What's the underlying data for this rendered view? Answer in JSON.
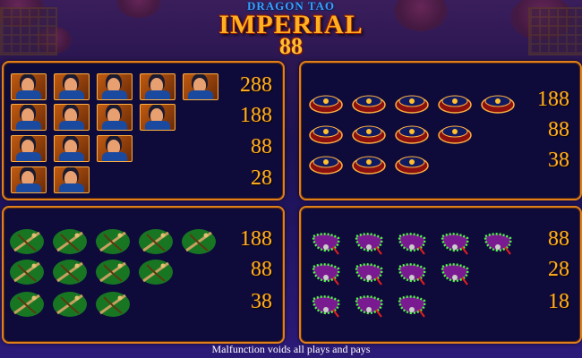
{
  "logo": {
    "subtitle": "DRAGON TAO",
    "title": "IMPERIAL",
    "number": "88"
  },
  "footer": {
    "text": "Malfunction voids all plays and pays"
  },
  "colors": {
    "panel_border": "#e0801a",
    "payout_text": "#ffb020",
    "panel_bg": "#0e0a3a"
  },
  "panels": [
    {
      "symbol": "warrior-icon",
      "rows": [
        {
          "count": 5,
          "payout": "288"
        },
        {
          "count": 4,
          "payout": "188"
        },
        {
          "count": 3,
          "payout": "88"
        },
        {
          "count": 2,
          "payout": "28"
        }
      ]
    },
    {
      "symbol": "hat-icon",
      "rows": [
        {
          "count": 5,
          "payout": "188"
        },
        {
          "count": 4,
          "payout": "88"
        },
        {
          "count": 3,
          "payout": "38"
        }
      ]
    },
    {
      "symbol": "crossbow-icon",
      "rows": [
        {
          "count": 5,
          "payout": "188"
        },
        {
          "count": 4,
          "payout": "88"
        },
        {
          "count": 3,
          "payout": "38"
        }
      ]
    },
    {
      "symbol": "beads-icon",
      "rows": [
        {
          "count": 5,
          "payout": "88"
        },
        {
          "count": 4,
          "payout": "28"
        },
        {
          "count": 3,
          "payout": "18"
        }
      ]
    }
  ]
}
